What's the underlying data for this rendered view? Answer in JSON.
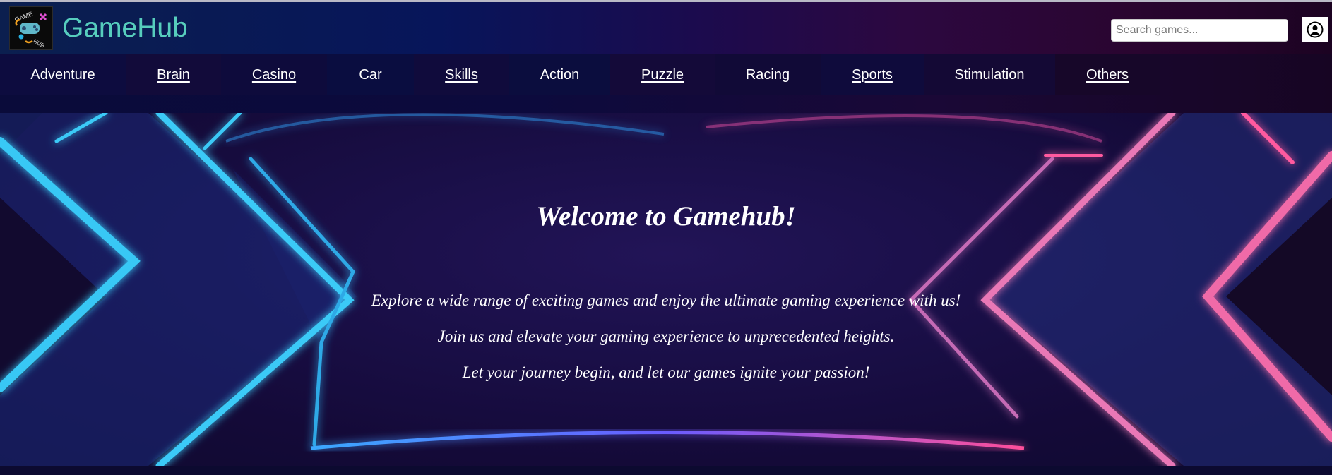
{
  "header": {
    "brand": "GameHub",
    "logo_icon": "gamehub-logo",
    "logo_text_top": "GAME",
    "logo_text_bottom": "HUB",
    "search_placeholder": "Search games...",
    "profile_icon": "user-circle-icon"
  },
  "nav": {
    "items": [
      {
        "label": "Adventure"
      },
      {
        "label": "Brain"
      },
      {
        "label": "Casino"
      },
      {
        "label": "Car"
      },
      {
        "label": "Skills"
      },
      {
        "label": "Action"
      },
      {
        "label": "Puzzle"
      },
      {
        "label": "Racing"
      },
      {
        "label": "Sports"
      },
      {
        "label": "Stimulation"
      },
      {
        "label": "Others"
      }
    ]
  },
  "hero": {
    "title": "Welcome to Gamehub!",
    "lines": [
      "Explore a wide range of exciting games and enjoy the ultimate gaming experience with us!",
      "Join us and elevate your gaming experience to unprecedented heights.",
      "Let your journey begin, and let our games ignite your passion!"
    ]
  },
  "colors": {
    "accent_cyan": "#2fbfd2",
    "accent_pink": "#e8699f",
    "nav_bg": "#0c0a3d",
    "hero_bg": "#1a0f48"
  }
}
